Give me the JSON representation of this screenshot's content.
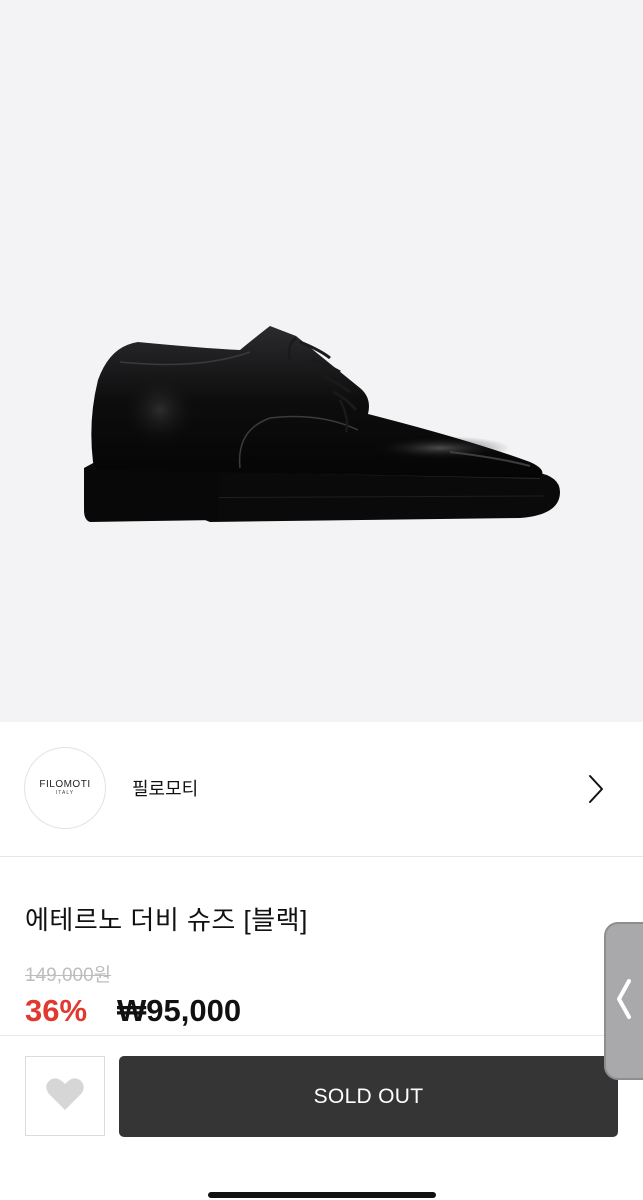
{
  "brand": {
    "logo_text": "FILOMOTI",
    "logo_subtext": "ITALY",
    "name": "필로모티"
  },
  "product": {
    "title": "에테르노 더비 슈즈 [블랙]",
    "original_price": "149,000원",
    "discount": "36%",
    "sale_price": "₩95,000"
  },
  "actions": {
    "sold_out_label": "SOLD OUT"
  },
  "icons": {
    "brand_chevron": "chevron-right-icon",
    "wishlist": "heart-icon",
    "side_tab": "chevron-left-icon"
  },
  "colors": {
    "discount": "#e03a2f",
    "sold_out_button": "#353535",
    "hero_background": "#f3f2f4"
  }
}
